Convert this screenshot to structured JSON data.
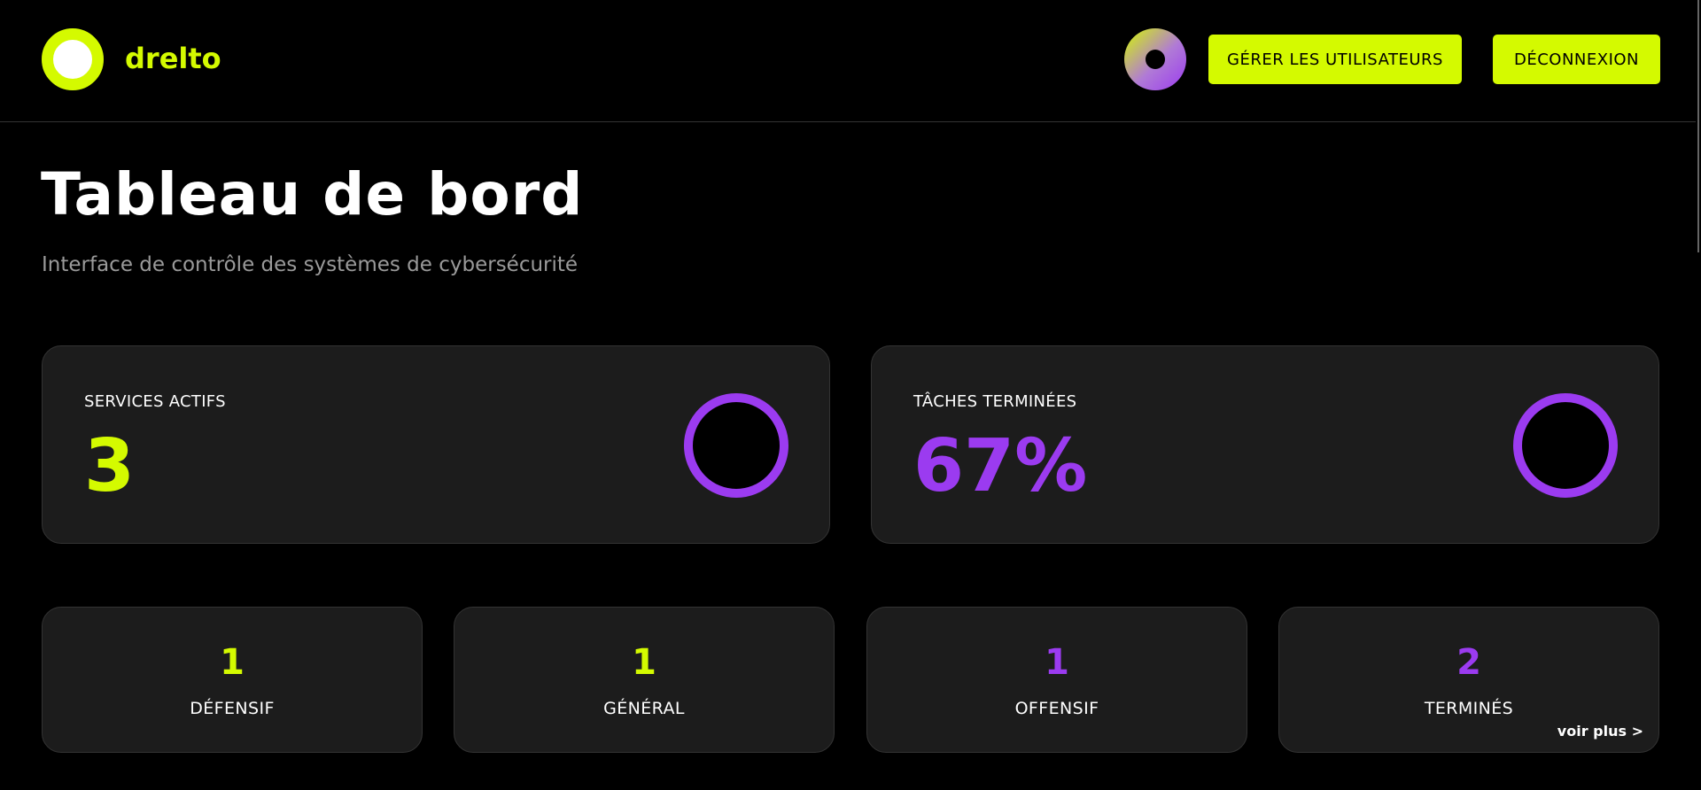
{
  "header": {
    "brand": "drelto",
    "manage_users_label": "GÉRER LES UTILISATEURS",
    "logout_label": "DÉCONNEXION"
  },
  "page": {
    "title": "Tableau de bord",
    "subtitle": "Interface de contrôle des systèmes de cybersécurité"
  },
  "stats": {
    "services": {
      "label": "SERVICES ACTIFS",
      "value": "3"
    },
    "tasks": {
      "label": "TÂCHES TERMINÉES",
      "value": "67%"
    }
  },
  "categories": [
    {
      "value": "1",
      "label": "DÉFENSIF",
      "color": "#d4fa00"
    },
    {
      "value": "1",
      "label": "GÉNÉRAL",
      "color": "#d4fa00"
    },
    {
      "value": "1",
      "label": "OFFENSIF",
      "color": "#9b3bf0"
    },
    {
      "value": "2",
      "label": "TERMINÉS",
      "color": "#9b3bf0"
    }
  ],
  "more_link": "voir plus >",
  "colors": {
    "accent_lime": "#d4fa00",
    "accent_purple": "#9b3bf0",
    "background": "#000000",
    "card": "#1c1c1c"
  },
  "icons": {
    "logo": "ring-logo-icon",
    "avatar": "gradient-avatar-icon",
    "stat_ring": "progress-ring-icon"
  }
}
